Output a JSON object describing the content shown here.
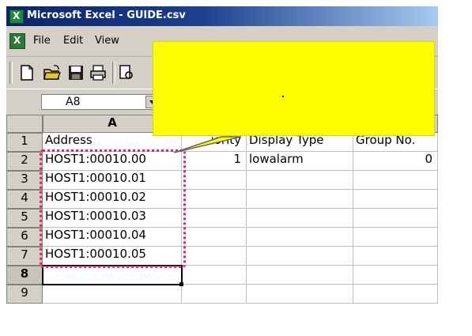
{
  "window": {
    "title": "Microsoft Excel - GUIDE.csv"
  },
  "menu": {
    "file": "File",
    "edit": "Edit",
    "view": "View"
  },
  "toolbar": {
    "buttons": [
      "new-icon",
      "open-icon",
      "save-icon",
      "print-icon"
    ]
  },
  "formula_bar": {
    "name_box": "A8"
  },
  "columns": {
    "a": "A"
  },
  "rows": [
    "1",
    "2",
    "3",
    "4",
    "5",
    "6",
    "7",
    "8",
    "9"
  ],
  "sheet": {
    "header": {
      "address": "Address",
      "priority": "iority",
      "display_type": "Display Type",
      "group_no": "Group No."
    },
    "row2": {
      "address": "HOST1:00010.00",
      "priority": "1",
      "display_type": "lowalarm",
      "group_no": "0"
    },
    "row3": {
      "address": "HOST1:00010.01"
    },
    "row4": {
      "address": "HOST1:00010.02"
    },
    "row5": {
      "address": "HOST1:00010.03"
    },
    "row6": {
      "address": "HOST1:00010.04"
    },
    "row7": {
      "address": "HOST1:00010.05"
    }
  },
  "colors": {
    "callout": "#ffff00",
    "highlight": "#e8245a",
    "titlebar": "#0a246a"
  }
}
